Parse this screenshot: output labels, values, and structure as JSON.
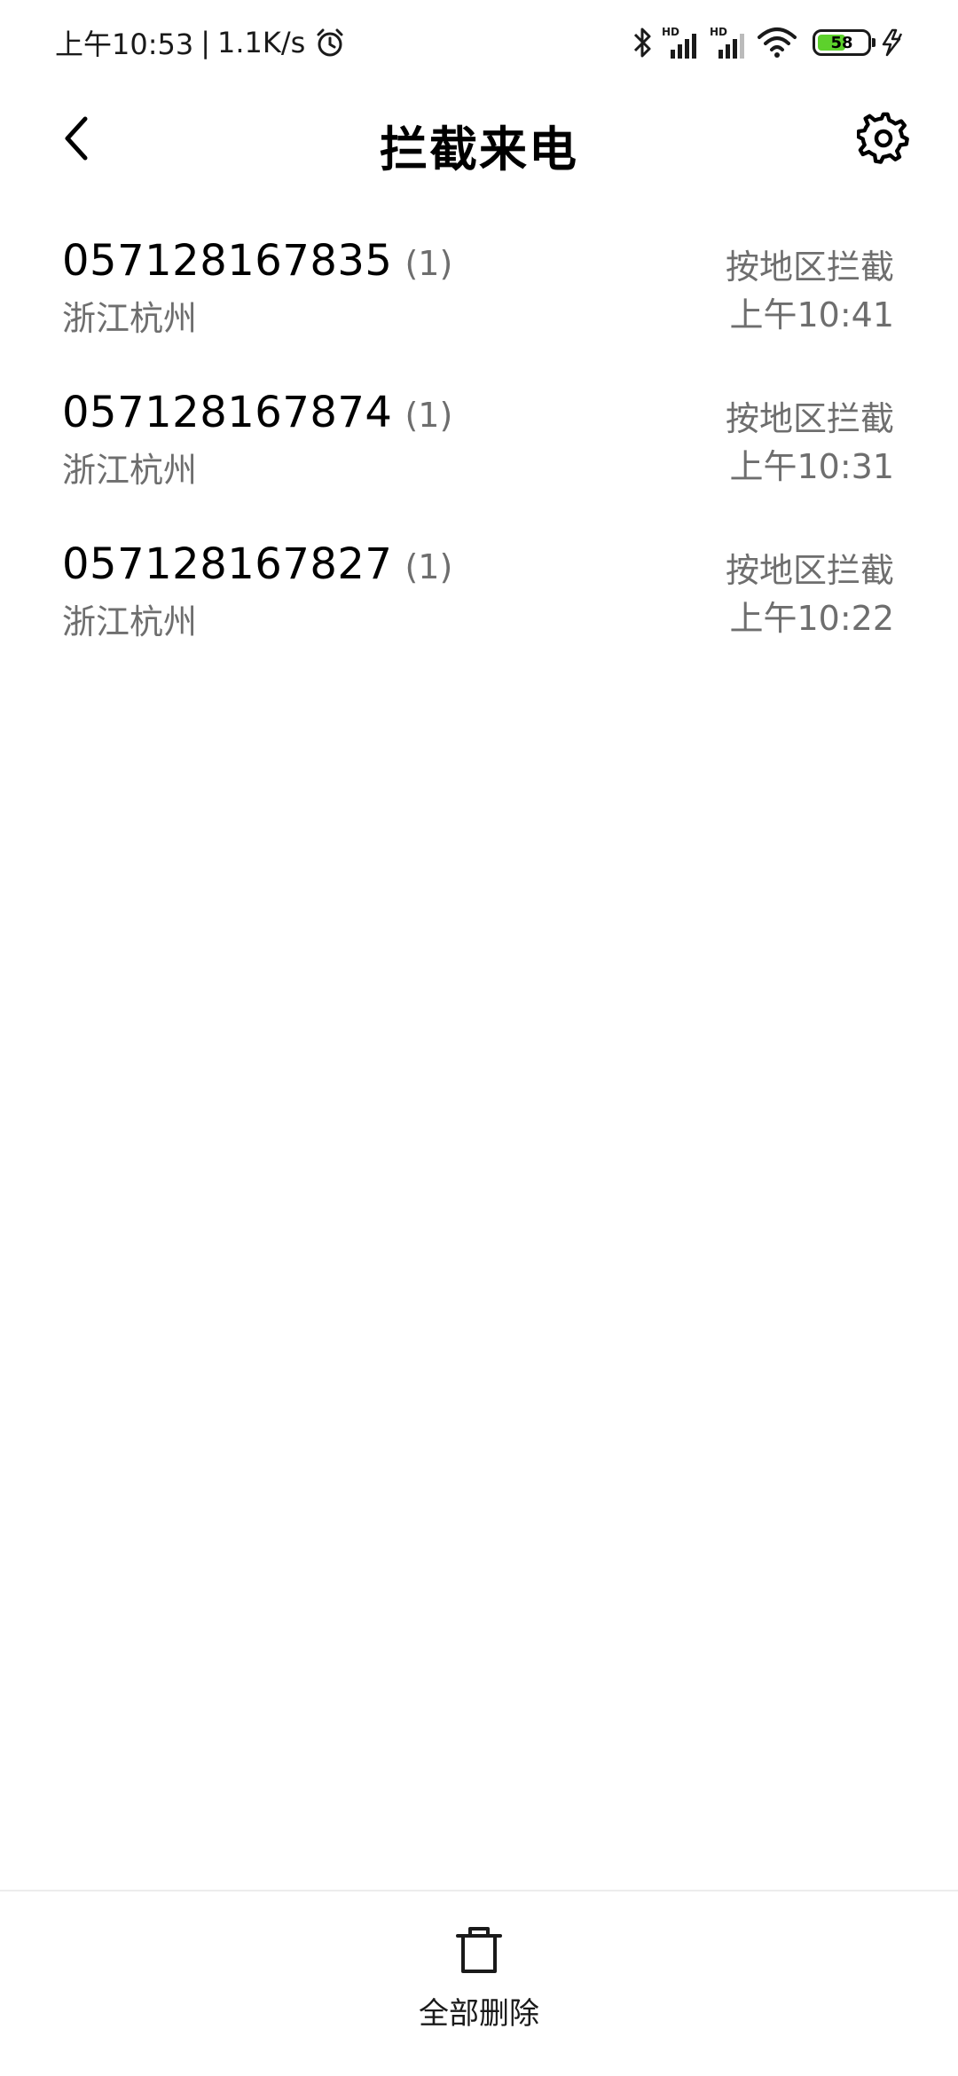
{
  "status_bar": {
    "time": "上午10:53",
    "separator": "|",
    "network_speed": "1.1K/s",
    "icons": [
      "alarm-icon",
      "bluetooth-icon",
      "signal-hd-icon",
      "signal-hd-icon",
      "wifi-icon",
      "battery-icon",
      "charging-icon"
    ],
    "battery_level": 58,
    "battery_text": "58",
    "hd_label": "HD"
  },
  "header": {
    "title": "拦截来电",
    "back_icon": "chevron-left-icon",
    "settings_icon": "gear-icon"
  },
  "calls": [
    {
      "number": "057128167835",
      "count": "(1)",
      "location": "浙江杭州",
      "reason": "按地区拦截",
      "time": "上午10:41"
    },
    {
      "number": "057128167874",
      "count": "(1)",
      "location": "浙江杭州",
      "reason": "按地区拦截",
      "time": "上午10:31"
    },
    {
      "number": "057128167827",
      "count": "(1)",
      "location": "浙江杭州",
      "reason": "按地区拦截",
      "time": "上午10:22"
    }
  ],
  "bottom_bar": {
    "delete_all_label": "全部删除",
    "delete_icon": "trash-icon"
  },
  "colors": {
    "battery_fill": "#5dd12c",
    "secondary_text": "#6e6e6e"
  }
}
